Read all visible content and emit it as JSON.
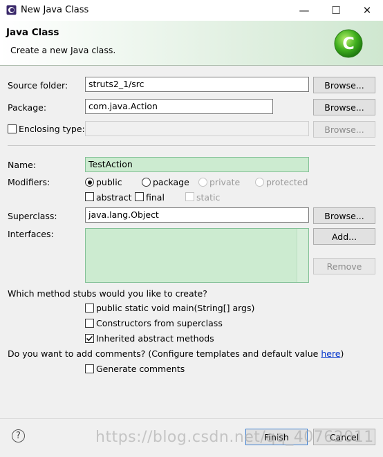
{
  "window": {
    "title": "New Java Class",
    "minimize": "—",
    "maximize": "☐",
    "close": "✕"
  },
  "banner": {
    "title": "Java Class",
    "description": "Create a new Java class.",
    "icon_letter": "C"
  },
  "source_folder": {
    "label": "Source folder:",
    "value": "struts2_1/src",
    "browse": "Browse..."
  },
  "package": {
    "label": "Package:",
    "value": "com.java.Action",
    "browse": "Browse..."
  },
  "enclosing": {
    "label": "Enclosing type:",
    "value": "",
    "checked": false,
    "browse": "Browse..."
  },
  "name": {
    "label": "Name:",
    "value": "TestAction"
  },
  "modifiers": {
    "label": "Modifiers:",
    "public": "public",
    "package": "package",
    "private": "private",
    "protected": "protected",
    "abstract": "abstract",
    "final": "final",
    "static": "static",
    "selected": "public"
  },
  "superclass": {
    "label": "Superclass:",
    "value": "java.lang.Object",
    "browse": "Browse..."
  },
  "interfaces": {
    "label": "Interfaces:",
    "add": "Add...",
    "remove": "Remove"
  },
  "stubs": {
    "question": "Which method stubs would you like to create?",
    "main": "public static void main(String[] args)",
    "constructors": "Constructors from superclass",
    "inherited": "Inherited abstract methods",
    "main_checked": false,
    "constructors_checked": false,
    "inherited_checked": true
  },
  "comments": {
    "question": "Do you want to add comments? (Configure templates and default value",
    "link": "here",
    "close_paren": ")",
    "generate": "Generate comments",
    "generate_checked": false
  },
  "footer": {
    "help": "?",
    "finish": "Finish",
    "cancel": "Cancel"
  },
  "watermark": "https://blog.csdn.net/qq_40762011",
  "colors": {
    "banner_green": "#cfe7d0",
    "field_green": "#ccebd0",
    "link": "#0033cc"
  }
}
